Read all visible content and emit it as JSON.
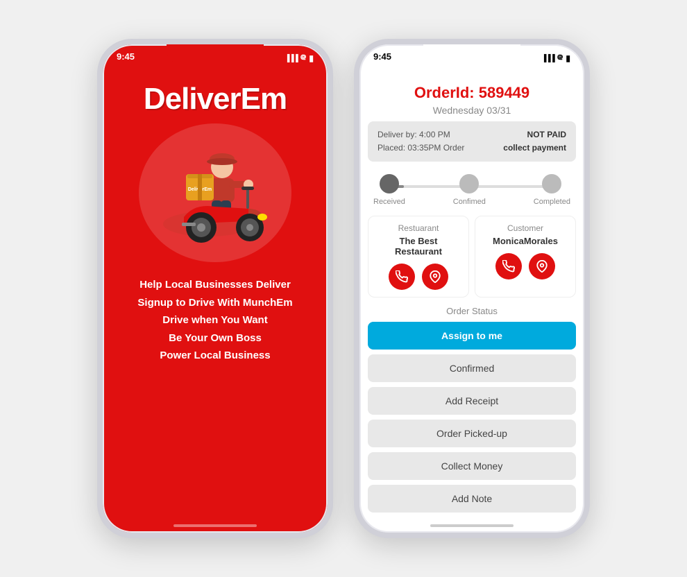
{
  "left_phone": {
    "status_time": "9:45",
    "logo": "DeliverEm",
    "taglines": [
      "Help Local Businesses Deliver",
      "Signup to Drive With MunchEm",
      "Drive when You Want",
      "Be Your Own Boss",
      "Power Local Business"
    ],
    "scooter_box_label": "DeliverEm"
  },
  "right_phone": {
    "status_time": "9:45",
    "order_title": "OrderId: 589449",
    "date": "Wednesday 03/31",
    "deliver_by": "Deliver by: 4:00 PM",
    "placed": "Placed: 03:35PM Order",
    "payment_status": "NOT PAID",
    "payment_action": "collect payment",
    "progress": {
      "steps": [
        "Received",
        "Confimed",
        "Completed"
      ],
      "active_step": 0
    },
    "restaurant": {
      "label": "Restuarant",
      "name": "The Best Restaurant"
    },
    "customer": {
      "label": "Customer",
      "name": "MonicaMorales"
    },
    "order_status_label": "Order Status",
    "buttons": [
      {
        "label": "Assign to me",
        "type": "primary"
      },
      {
        "label": "Confirmed",
        "type": "secondary"
      },
      {
        "label": "Add Receipt",
        "type": "secondary"
      },
      {
        "label": "Order Picked-up",
        "type": "secondary"
      },
      {
        "label": "Collect Money",
        "type": "secondary"
      },
      {
        "label": "Add Note",
        "type": "secondary"
      }
    ]
  }
}
